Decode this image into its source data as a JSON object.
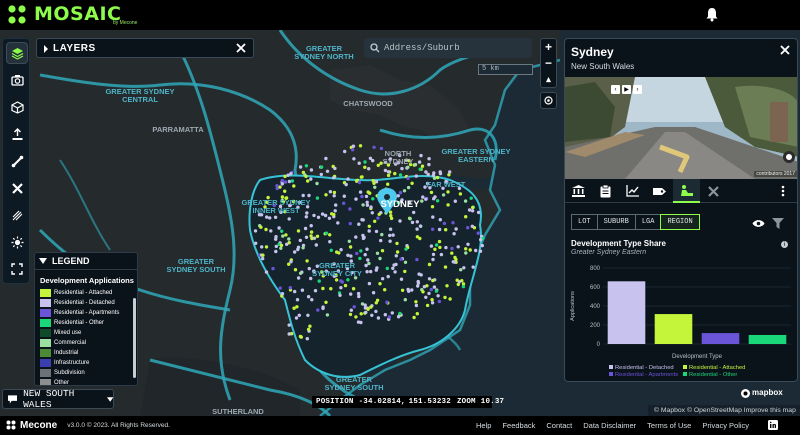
{
  "app": {
    "brand": "MOSAIC",
    "brand_sub": "by Mecone"
  },
  "layers_panel": {
    "label": "LAYERS"
  },
  "search": {
    "placeholder": "Address/Suburb"
  },
  "zoom_controls": {
    "in": "+",
    "out": "−",
    "reset": "▴"
  },
  "scale_bar": {
    "label": "5 km"
  },
  "map_labels": [
    {
      "text": "GREATER\nSYDNEY NORTH",
      "color": "#4fb5c8"
    },
    {
      "text": "GREATER SYDNEY\nCENTRAL",
      "color": "#4fb5c8"
    },
    {
      "text": "PARRAMATTA",
      "color": "#9ca8b0"
    },
    {
      "text": "CHATSWOOD",
      "color": "#9ca8b0"
    },
    {
      "text": "NORTH\nSYDNEY",
      "color": "#9ca8b0"
    },
    {
      "text": "GREATER SYDNEY\nEASTERN",
      "color": "#4fb5c8"
    },
    {
      "text": "FAR WEST",
      "color": "#4fb5c8"
    },
    {
      "text": "GREATER SYDNEY\nINNER WEST",
      "color": "#4fb5c8"
    },
    {
      "text": "SYDNEY",
      "color": "#ffffff"
    },
    {
      "text": "GREATER\nSYDNEY SOUTH",
      "color": "#4fb5c8"
    },
    {
      "text": "GREATER\nSYDNEY CITY",
      "color": "#4fb5c8"
    },
    {
      "text": "GREATER\nSYDNEY SOUTH",
      "color": "#4fb5c8"
    },
    {
      "text": "SUTHERLAND",
      "color": "#9ca8b0"
    }
  ],
  "legend": {
    "header": "LEGEND",
    "title": "Development Applications",
    "items": [
      {
        "label": "Residential - Attached",
        "color": "#c4f53a"
      },
      {
        "label": "Residential - Detached",
        "color": "#c8c3ee"
      },
      {
        "label": "Residential - Apartments",
        "color": "#6a54d8"
      },
      {
        "label": "Residential - Other",
        "color": "#1ad879"
      },
      {
        "label": "Mixed use",
        "color": "#0f4a2a"
      },
      {
        "label": "Commercial",
        "color": "#9be0a0"
      },
      {
        "label": "Industrial",
        "color": "#4e8a35"
      },
      {
        "label": "Infrastructure",
        "color": "#3a3fb0"
      },
      {
        "label": "Subdivision",
        "color": "#6b7278"
      },
      {
        "label": "Other",
        "color": "#8e8e8e"
      }
    ]
  },
  "region_selector": {
    "value": "NEW SOUTH WALES"
  },
  "position_bar": {
    "label": "POSITION",
    "lat": "-34.02814",
    "lng": "151.53232",
    "zoom_label": "ZOOM",
    "zoom": "10.37"
  },
  "panel": {
    "title": "Sydney",
    "subtitle": "New South Wales",
    "streetview_credit": "contributors 2017",
    "tabs": [
      {
        "icon": "bank-icon"
      },
      {
        "icon": "clipboard-icon"
      },
      {
        "icon": "chart-icon"
      },
      {
        "icon": "ticket-icon"
      },
      {
        "icon": "development-icon"
      },
      {
        "icon": "tools-icon"
      }
    ],
    "geo_levels": [
      "LOT",
      "SUBURB",
      "LGA",
      "REGION"
    ],
    "active_geo": "REGION",
    "chart_title": "Development Type Share",
    "chart_subtitle": "Greater Sydney Eastern"
  },
  "chart_data": {
    "type": "bar",
    "title": "Development Type Share",
    "subtitle": "Greater Sydney Eastern",
    "categories": [
      "Residential - Detached",
      "Residential - Attached",
      "Residential - Apartments",
      "Residential - Other"
    ],
    "values": [
      660,
      315,
      115,
      95
    ],
    "colors": [
      "#c8c3ee",
      "#c4f53a",
      "#6a54d8",
      "#1ad879"
    ],
    "xlabel": "Development Type",
    "ylabel": "Applications",
    "yticks": [
      0,
      200,
      400,
      600,
      800
    ],
    "ylim": [
      0,
      800
    ],
    "legend_position": "bottom"
  },
  "attribution": {
    "mapbox": "mapbox",
    "text": "© Mapbox © OpenStreetMap  Improve this map"
  },
  "footer": {
    "brand": "Mecone",
    "version": "v3.0.0 © 2023. All Rights Reserved.",
    "links": [
      "Help",
      "Feedback",
      "Contact",
      "Data Disclaimer",
      "Terms of Use",
      "Privacy Policy"
    ]
  }
}
